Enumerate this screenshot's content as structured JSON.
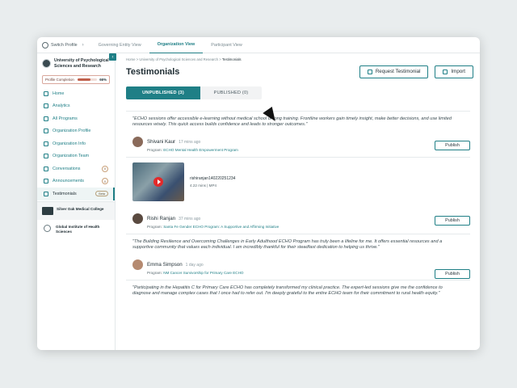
{
  "topbar": {
    "switch_label": "Switch Profile",
    "tabs": [
      "Governing Entity View",
      "Organization View",
      "Participant View"
    ]
  },
  "sidebar": {
    "org_name": "University of Psychological Sciences and Research",
    "profile_completion_label": "Profile Completion",
    "profile_completion_value": "66%",
    "profile_completion_fraction": 0.66,
    "items": [
      {
        "label": "Home"
      },
      {
        "label": "Analytics"
      },
      {
        "label": "All Programs"
      },
      {
        "label": "Organization Profile"
      },
      {
        "label": "Organization Info"
      },
      {
        "label": "Organization Team"
      },
      {
        "label": "Conversations",
        "count": "0"
      },
      {
        "label": "Announcements",
        "count": "0"
      },
      {
        "label": "Testimonials",
        "badge": "Beta"
      }
    ],
    "orgs": [
      {
        "name": "Silver Oak Medical College"
      },
      {
        "name": "Global Institute of Health Sciences"
      }
    ]
  },
  "main": {
    "breadcrumb": {
      "home": "Home",
      "org": "University of Psychological Sciences and Research",
      "current": "Testimonials",
      "sep": ">"
    },
    "title": "Testimonials",
    "request_button": "Request Testimonial",
    "import_button": "Import",
    "tabs": {
      "unpublished": "UNPUBLISHED (3)",
      "published": "PUBLISHED (0)"
    },
    "publish_label": "Publish",
    "cards": [
      {
        "quote": "\"ECHO sessions offer accessible e-learning without medical school or long training. Frontline workers gain timely insight, make better decisions, and use limited resources wisely. This quick access builds confidence and leads to stronger outcomes.\"",
        "name": "Shivani Kaur",
        "time": "17 mins ago",
        "program_prefix": "Program:",
        "program": "ECHO Mental Health Empowerment Program"
      },
      {
        "video_name": "rishiranjan140220251234",
        "video_meta": "4.22 mins | MP4",
        "name": "Rishi Ranjan",
        "time": "37 mins ago",
        "program_prefix": "Program:",
        "program": "Santa Fe Gender ECHO Program: A Supportive and Affirming Initiative"
      },
      {
        "quote": "\"The Building Resilience and Overcoming Challenges in Early Adulthood ECHO Program has truly been a lifeline for me. It offers essential resources and a supportive community that values each individual. I am incredibly thankful for their steadfast dedication to helping us thrive.\"",
        "name": "Emma Simpson",
        "time": "1 day ago",
        "program_prefix": "Program:",
        "program": "NM Cancer Survivorship for Primary Care ECHO"
      },
      {
        "quote": "\"Participating in the Hepatitis C for Primary Care ECHO has completely transformed my clinical practice. The expert-led sessions give me the confidence to diagnose and manage complex cases that I once had to refer out. I'm deeply grateful to the entire ECHO team for their commitment to rural health equity.\""
      }
    ]
  },
  "colors": {
    "accent": "#1f7f86",
    "background": "#e9edee"
  }
}
